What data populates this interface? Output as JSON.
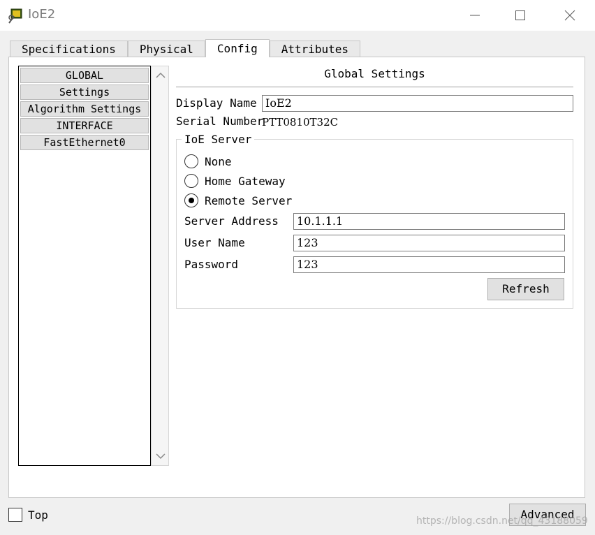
{
  "window": {
    "title": "IoE2",
    "controls": {
      "minimize": "minimize-icon",
      "maximize": "maximize-icon",
      "close": "close-icon"
    }
  },
  "tabs": [
    {
      "label": "Specifications",
      "active": false
    },
    {
      "label": "Physical",
      "active": false
    },
    {
      "label": "Config",
      "active": true
    },
    {
      "label": "Attributes",
      "active": false
    }
  ],
  "nav": {
    "items": [
      "GLOBAL",
      "Settings",
      "Algorithm Settings",
      "INTERFACE",
      "FastEthernet0"
    ]
  },
  "global_settings": {
    "title": "Global Settings",
    "display_name_label": "Display Name",
    "display_name_value": "IoE2",
    "serial_number_label": "Serial Number",
    "serial_number_value": "PTT0810T32C"
  },
  "ioe_server": {
    "legend": "IoE Server",
    "options": [
      {
        "label": "None",
        "checked": false
      },
      {
        "label": "Home Gateway",
        "checked": false
      },
      {
        "label": "Remote Server",
        "checked": true
      }
    ],
    "server_address_label": "Server Address",
    "server_address_value": "10.1.1.1",
    "user_name_label": "User Name",
    "user_name_value": "123",
    "password_label": "Password",
    "password_value": "123",
    "refresh_label": "Refresh"
  },
  "footer": {
    "top_label": "Top",
    "top_checked": false,
    "advanced_label": "Advanced"
  },
  "watermark": "https://blog.csdn.net/qq_43188059"
}
